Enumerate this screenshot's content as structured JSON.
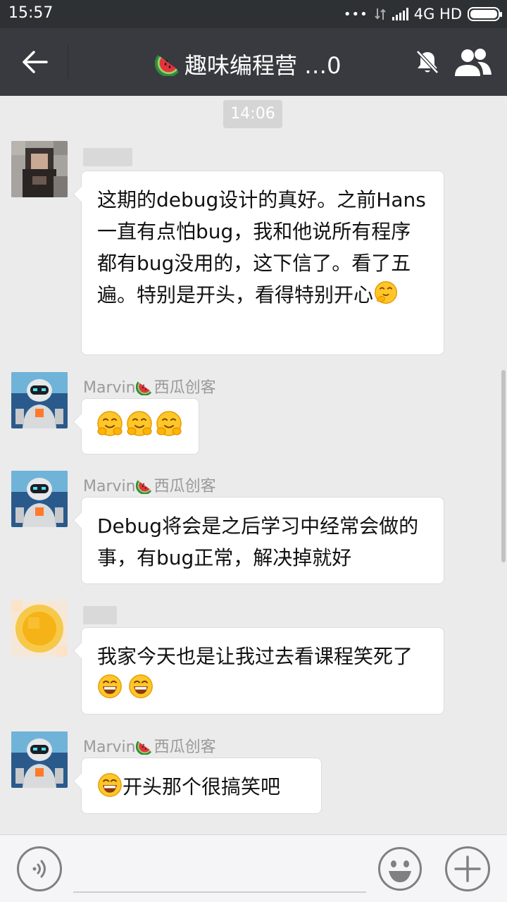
{
  "status_bar": {
    "time": "15:57",
    "dots": "•••",
    "network": "4G HD"
  },
  "nav": {
    "title": "趣味编程营 …0"
  },
  "chat": {
    "timestamp": "14:06",
    "messages": [
      {
        "sender": "",
        "avatar": "blurred-photo-avatar",
        "text": "这期的debug设计的真好。之前Hans一直有点怕bug，我和他说所有程序都有bug没用的，这下信了。看了五遍。特别是开头，看得特别开心"
      },
      {
        "sender": "Marvin",
        "sender_suffix": "西瓜创客",
        "avatar": "robot-avatar",
        "text": ""
      },
      {
        "sender": "Marvin",
        "sender_suffix": "西瓜创客",
        "avatar": "robot-avatar",
        "text": "Debug将会是之后学习中经常会做的事，有bug正常，解决掉就好"
      },
      {
        "sender": "",
        "avatar": "blurred-yellow-avatar",
        "text": "我家今天也是让我过去看课程笑死了"
      },
      {
        "sender": "Marvin",
        "sender_suffix": "西瓜创客",
        "avatar": "robot-avatar",
        "text": "开头那个很搞笑吧"
      }
    ]
  },
  "input": {
    "placeholder": ""
  },
  "colors": {
    "nav_bg": "#393a3f",
    "status_bg": "#2e3133",
    "chat_bg": "#ebebeb",
    "bubble_bg": "#ffffff",
    "sender_text": "#9a9a9a"
  }
}
